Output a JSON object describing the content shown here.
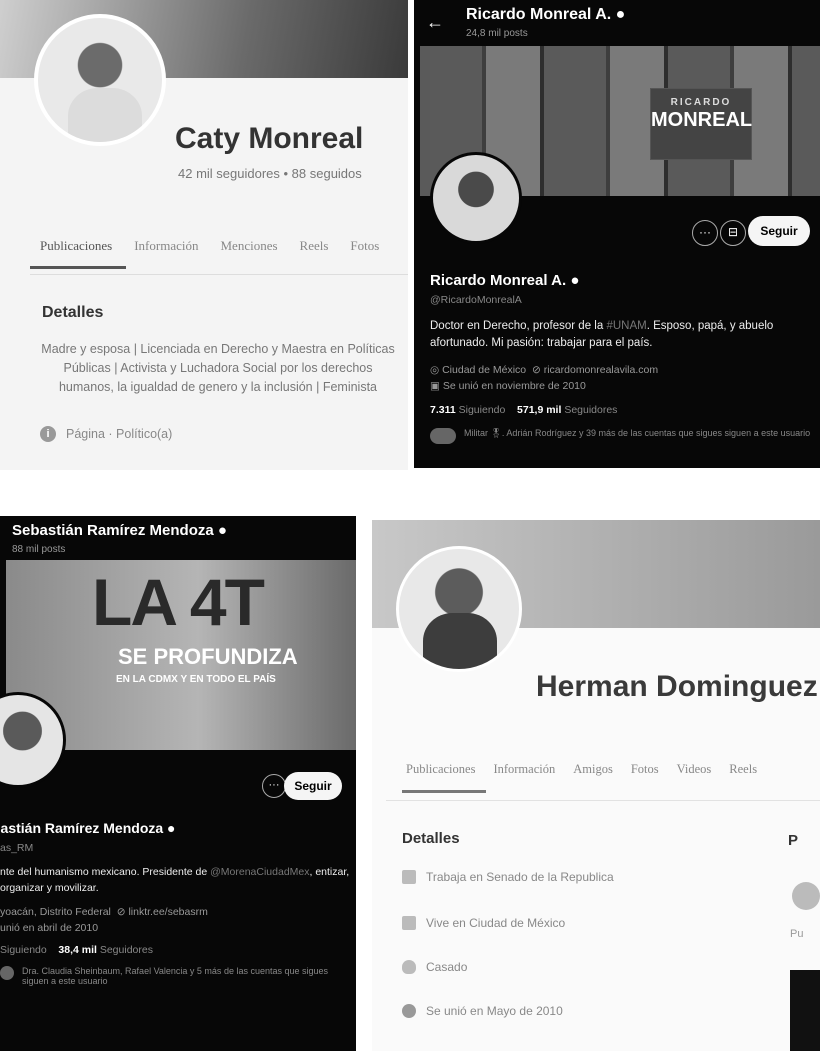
{
  "caty": {
    "name": "Caty Monreal",
    "stats": "42 mil seguidores • 88 seguidos",
    "tabs": [
      "Publicaciones",
      "Información",
      "Menciones",
      "Reels",
      "Fotos"
    ],
    "details_heading": "Detalles",
    "bio": "Madre y esposa | Licenciada en Derecho y Maestra en Políticas Públicas | Activista y Luchadora Social por los derechos humanos, la igualdad de genero y la inclusión | Feminista",
    "page_label": "Página · Político(a)"
  },
  "ricardo": {
    "header_name": "Ricardo Monreal A.",
    "header_posts": "24,8 mil posts",
    "banner_line1": "RICARDO",
    "banner_line2": "MONREAL",
    "follow_label": "Seguir",
    "name": "Ricardo Monreal A.",
    "handle": "@RicardoMonrealA",
    "bio_pre": "Doctor en Derecho, profesor de la ",
    "bio_tag": "#UNAM",
    "bio_post": ". Esposo, papá, y abuelo afortunado. Mi pasión: trabajar para el país.",
    "location": "Ciudad de México",
    "website": "ricardomonrealavila.com",
    "joined": "Se unió en noviembre de 2010",
    "following_count": "7.311",
    "following_label": "Siguiendo",
    "followers_count": "571,9 mil",
    "followers_label": "Seguidores",
    "followed_by": "Militar 🎖. Adrián Rodríguez y 39 más de las cuentas que sigues siguen a este usuario"
  },
  "sebastian": {
    "header_name": "Sebastián Ramírez Mendoza",
    "header_posts": "88 mil posts",
    "banner_big": "LA 4T",
    "banner_mid": "SE PROFUNDIZA",
    "banner_small": "EN LA CDMX Y EN TODO EL PAÍS",
    "follow_label": "Seguir",
    "name": "bastián Ramírez Mendoza",
    "handle": "as_RM",
    "bio_pre": "nte del humanismo mexicano. Presidente de ",
    "bio_tag": "@MorenaCiudadMex",
    "bio_post": ", entizar, organizar y movilizar.",
    "location": "yoacán, Distrito Federal",
    "website": "linktr.ee/sebasrm",
    "joined": "unió en abril de 2010",
    "following_label": "Siguiendo",
    "followers_count": "38,4 mil",
    "followers_label": "Seguidores",
    "followed_by": "Dra. Claudia Sheinbaum, Rafael Valencia y 5 más de las cuentas que sigues siguen a este usuario"
  },
  "herman": {
    "name": "Herman Dominguez",
    "tabs": [
      "Publicaciones",
      "Información",
      "Amigos",
      "Fotos",
      "Videos",
      "Reels"
    ],
    "details_heading": "Detalles",
    "side_heading": "P",
    "work": "Trabaja en Senado de la Republica",
    "lives": "Vive en Ciudad de México",
    "status": "Casado",
    "joined": "Se unió en Mayo de 2010",
    "side_text": "Pu"
  }
}
